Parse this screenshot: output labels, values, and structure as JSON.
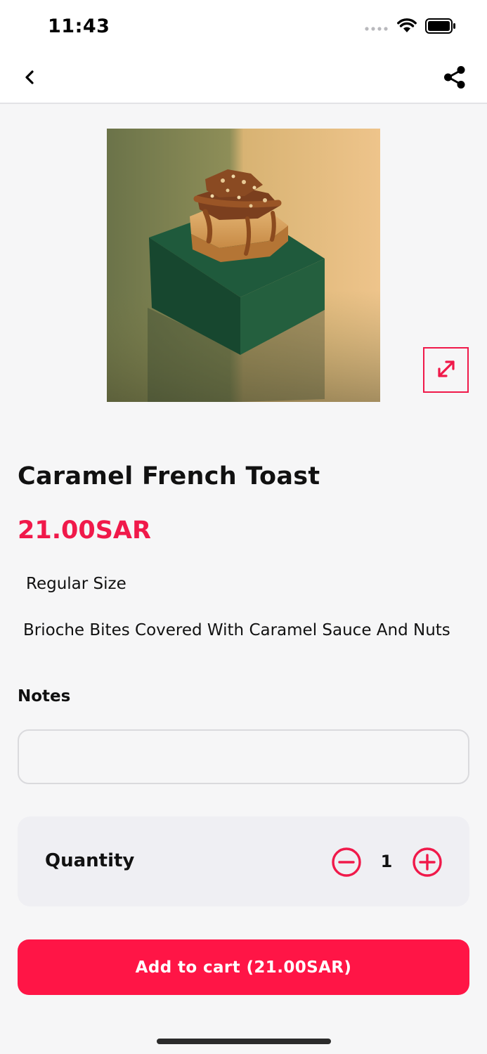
{
  "status_bar": {
    "time": "11:43",
    "icons": [
      "cellular-signal-icon",
      "wifi-icon",
      "battery-icon"
    ]
  },
  "nav": {
    "back_icon": "chevron-left-icon",
    "share_icon": "share-icon"
  },
  "product": {
    "image_alt": "Caramel French Toast",
    "expand_icon": "expand-icon",
    "title": "Caramel French Toast",
    "price": "21.00SAR",
    "size": "Regular Size",
    "description": "Brioche Bites Covered With Caramel Sauce And Nuts"
  },
  "notes": {
    "label": "Notes",
    "value": "",
    "placeholder": ""
  },
  "quantity": {
    "label": "Quantity",
    "value": "1",
    "minus_icon": "minus-circle-icon",
    "plus_icon": "plus-circle-icon"
  },
  "cart": {
    "button_label": "Add to cart (21.00SAR)"
  },
  "colors": {
    "accent": "#ff1546",
    "price": "#f0194a",
    "background": "#f6f6f7",
    "card": "#efeff3"
  }
}
